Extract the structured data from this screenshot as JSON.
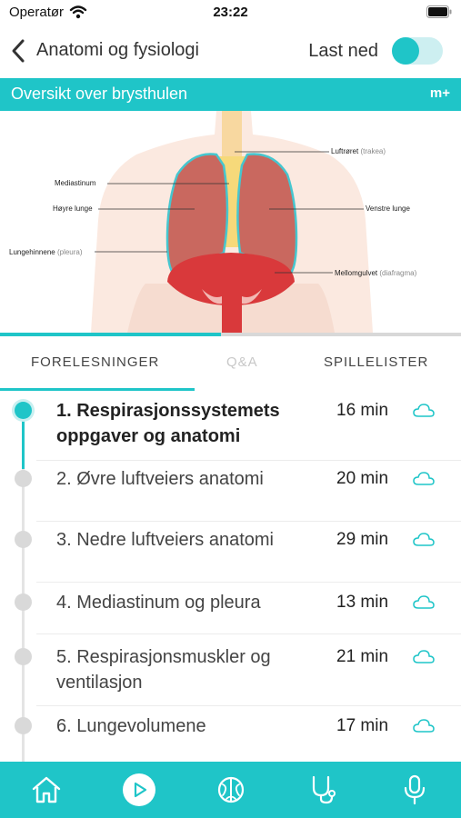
{
  "status": {
    "carrier": "Operatør",
    "time": "23:22"
  },
  "nav": {
    "title": "Anatomi og fysiologi",
    "download_label": "Last ned",
    "download_enabled": true
  },
  "banner": {
    "title": "Oversikt over brysthulen",
    "badge": "m+"
  },
  "figure_labels": {
    "trachea": "Luftrøret",
    "trachea_latin": "(trakea)",
    "mediastinum": "Mediastinum",
    "right_lung": "Høyre lunge",
    "left_lung": "Venstre lunge",
    "pleura": "Lungehinnene",
    "pleura_latin": "(pleura)",
    "diaphragm": "Mellomgulvet",
    "diaphragm_latin": "(diafragma)"
  },
  "playback_progress": 0.48,
  "tabs": [
    {
      "label": "FORELESNINGER",
      "active": true
    },
    {
      "label": "Q&A",
      "active": false
    },
    {
      "label": "SPILLELISTER",
      "active": false
    }
  ],
  "lectures": [
    {
      "title": "1. Respirasjonssystemets oppgaver og anatomi",
      "duration": "16 min",
      "active": true
    },
    {
      "title": "2. Øvre luftveiers anatomi",
      "duration": "20 min",
      "active": false
    },
    {
      "title": "3. Nedre luftveiers anatomi",
      "duration": "29 min",
      "active": false
    },
    {
      "title": "4. Mediastinum og pleura",
      "duration": "13 min",
      "active": false
    },
    {
      "title": "5. Respirasjonsmuskler og ventilasjon",
      "duration": "21 min",
      "active": false
    },
    {
      "title": "6. Lungevolumene",
      "duration": "17 min",
      "active": false
    }
  ],
  "tabbar": [
    {
      "icon": "home-icon"
    },
    {
      "icon": "play-icon"
    },
    {
      "icon": "brain-icon"
    },
    {
      "icon": "stethoscope-icon"
    },
    {
      "icon": "microphone-icon"
    }
  ],
  "colors": {
    "accent": "#1fc5c8",
    "lung": "#c9685f",
    "diaphragm": "#d9393b"
  }
}
